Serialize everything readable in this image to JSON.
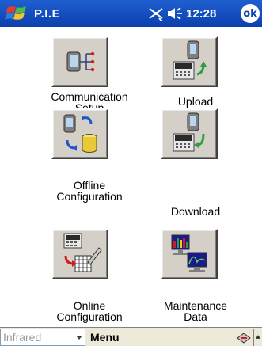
{
  "titlebar": {
    "app_title": "P.I.E",
    "clock": "12:28",
    "ok_label": "ok",
    "icons": [
      "windows-start-flag",
      "connectivity-icon",
      "volume-icon"
    ]
  },
  "menu": [
    {
      "id": "communication-setup",
      "label_lines": [
        "Communication",
        "Setup"
      ],
      "icon": "pda-connection-icon"
    },
    {
      "id": "upload",
      "label_lines": [
        "Upload"
      ],
      "icon": "upload-to-pda-icon"
    },
    {
      "id": "offline-configuration",
      "label_lines": [
        "Offline",
        "Configuration"
      ],
      "icon": "pda-database-sync-icon"
    },
    {
      "id": "download",
      "label_lines": [
        "Download"
      ],
      "icon": "download-from-pda-icon"
    },
    {
      "id": "online-configuration",
      "label_lines": [
        "Online",
        "Configuration"
      ],
      "icon": "device-grid-edit-icon"
    },
    {
      "id": "maintenance-data",
      "label_lines": [
        "Maintenance",
        "Data"
      ],
      "icon": "monitors-chart-icon"
    }
  ],
  "bottombar": {
    "input_method": "Infrared",
    "menu_label": "Menu",
    "icons": [
      "dropdown-arrow-icon",
      "keyboard-sip-icon",
      "scroll-up-icon"
    ]
  },
  "colors": {
    "titlebar": "#0b3fae",
    "button_face": "#d4d0c8",
    "accent_green": "#2e9e3e",
    "accent_red": "#d21c1c"
  }
}
